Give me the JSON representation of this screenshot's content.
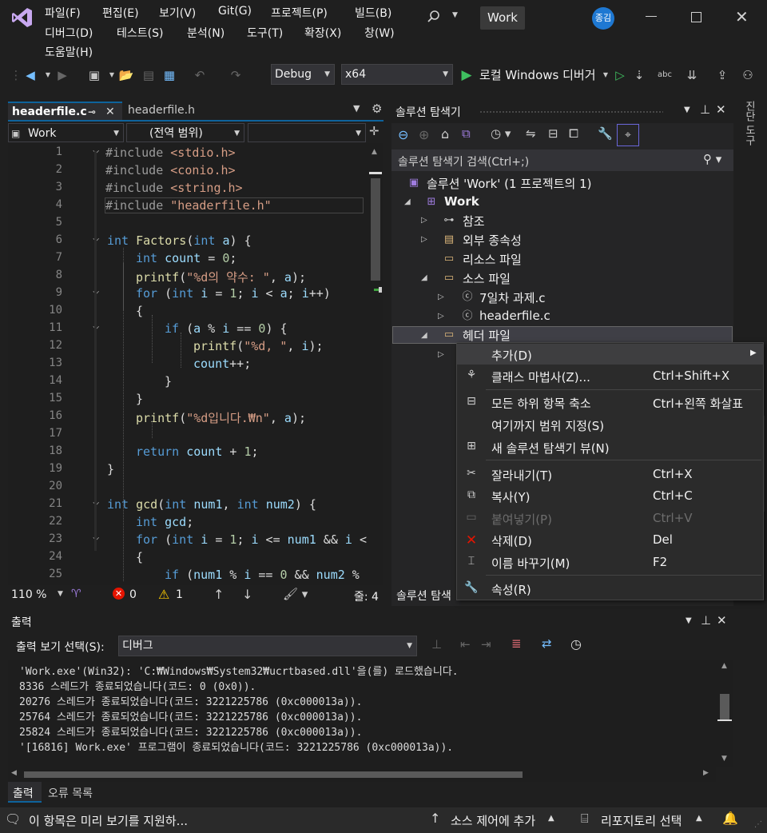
{
  "menu": {
    "file": "파일(F)",
    "edit": "편집(E)",
    "view": "보기(V)",
    "git": "Git(G)",
    "project": "프로젝트(P)",
    "build": "빌드(B)",
    "debug": "디버그(D)",
    "test": "테스트(S)",
    "analyze": "분석(N)",
    "tools": "도구(T)",
    "extensions": "확장(X)",
    "window": "창(W)",
    "help": "도움말(H)"
  },
  "window": {
    "solution_name": "Work",
    "avatar_initials": "종김"
  },
  "toolbar": {
    "config": "Debug",
    "platform": "x64",
    "run_label": "로컬 Windows 디버거"
  },
  "editor": {
    "tabs": [
      {
        "label": "headerfile.c",
        "active": true
      },
      {
        "label": "headerfile.h",
        "active": false
      }
    ],
    "nav": {
      "project": "Work",
      "scope": "(전역 범위)"
    },
    "zoom": "110 %",
    "errors": "0",
    "warnings": "1",
    "line_info": "줄: 4",
    "lines": [
      {
        "n": "1",
        "code": "#include <stdio.h>"
      },
      {
        "n": "2",
        "code": "#include <conio.h>"
      },
      {
        "n": "3",
        "code": "#include <string.h>"
      },
      {
        "n": "4",
        "code": "#include \"headerfile.h\""
      },
      {
        "n": "5",
        "code": ""
      },
      {
        "n": "6",
        "code": "int Factors(int a) {"
      },
      {
        "n": "7",
        "code": "int count = 0;"
      },
      {
        "n": "8",
        "code": "printf(\"%d의 약수: \", a);"
      },
      {
        "n": "9",
        "code": "for (int i = 1; i < a; i++)"
      },
      {
        "n": "10",
        "code": "{"
      },
      {
        "n": "11",
        "code": "if (a % i == 0) {"
      },
      {
        "n": "12",
        "code": "printf(\"%d, \", i);"
      },
      {
        "n": "13",
        "code": "count++;"
      },
      {
        "n": "14",
        "code": "}"
      },
      {
        "n": "15",
        "code": "}"
      },
      {
        "n": "16",
        "code": "printf(\"%d입니다.₩n\", a);"
      },
      {
        "n": "17",
        "code": ""
      },
      {
        "n": "18",
        "code": "return count + 1;"
      },
      {
        "n": "19",
        "code": "}"
      },
      {
        "n": "20",
        "code": ""
      },
      {
        "n": "21",
        "code": "int gcd(int num1, int num2) {"
      },
      {
        "n": "22",
        "code": "int gcd;"
      },
      {
        "n": "23",
        "code": "for (int i = 1; i <= num1 && i <"
      },
      {
        "n": "24",
        "code": "{"
      },
      {
        "n": "25",
        "code": "if (num1 % i == 0 && num2 %"
      }
    ]
  },
  "solution_explorer": {
    "title": "솔루션 탐색기",
    "search_placeholder": "솔루션 탐색기 검색(Ctrl+;)",
    "solution_label": "솔루션 'Work' (1 프로젝트의 1)",
    "project": "Work",
    "references": "참조",
    "external_deps": "외부 종속성",
    "resource_files": "리소스 파일",
    "source_files": "소스 파일",
    "file_1": "7일차 과제.c",
    "file_2": "headerfile.c",
    "header_files": "헤더 파일",
    "bottom_tab": "솔루션 탐색"
  },
  "context_menu": {
    "add": "추가(D)",
    "class_wizard": "클래스 마법사(Z)...",
    "class_wizard_sc": "Ctrl+Shift+X",
    "collapse_all": "모든 하위 항목 축소",
    "collapse_all_sc": "Ctrl+왼쪽 화살표",
    "scope_to_this": "여기까지 범위 지정(S)",
    "new_view": "새 솔루션 탐색기 뷰(N)",
    "cut": "잘라내기(T)",
    "cut_sc": "Ctrl+X",
    "copy": "복사(Y)",
    "copy_sc": "Ctrl+C",
    "paste": "붙여넣기(P)",
    "paste_sc": "Ctrl+V",
    "delete": "삭제(D)",
    "delete_sc": "Del",
    "rename": "이름 바꾸기(M)",
    "rename_sc": "F2",
    "properties": "속성(R)"
  },
  "side_tab": "진단 도구",
  "output": {
    "title": "출력",
    "source_label": "출력 보기 선택(S):",
    "source_value": "디버그",
    "lines": [
      "'Work.exe'(Win32): 'C:₩Windows₩System32₩ucrtbased.dll'을(를) 로드했습니다.",
      "8336 스레드가 종료되었습니다(코드: 0 (0x0)).",
      "20276 스레드가 종료되었습니다(코드: 3221225786 (0xc000013a)).",
      "25764 스레드가 종료되었습니다(코드: 3221225786 (0xc000013a)).",
      "25824 스레드가 종료되었습니다(코드: 3221225786 (0xc000013a)).",
      "'[16816] Work.exe' 프로그램이 종료되었습니다(코드: 3221225786 (0xc000013a))."
    ],
    "tabs": [
      "출력",
      "오류 목록"
    ]
  },
  "statusbar": {
    "message": "이 항목은 미리 보기를 지원하...",
    "source_control": "소스 제어에 추가",
    "repo": "리포지토리 선택"
  }
}
